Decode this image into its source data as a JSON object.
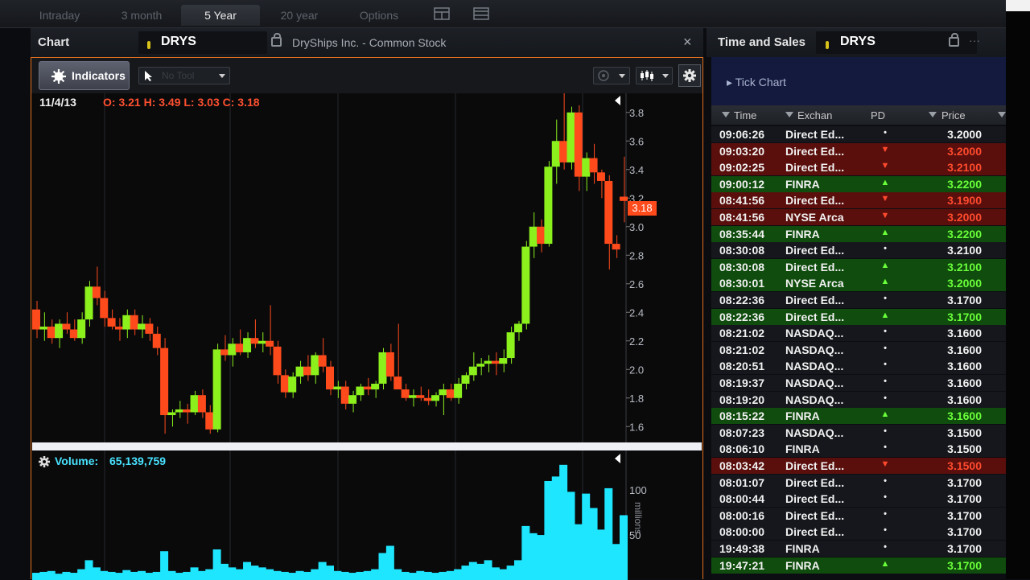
{
  "top_tabs": [
    "Intraday",
    "3 month",
    "5 Year",
    "20 year",
    "Options"
  ],
  "active_tab": "5 Year",
  "chart_header": {
    "title": "Chart",
    "symbol": "DRYS",
    "description": "DryShips Inc. - Common Stock",
    "close": "×"
  },
  "ts_header": {
    "title": "Time and Sales",
    "symbol": "DRYS"
  },
  "toolbar": {
    "indicators": "Indicators",
    "tool_placeholder": "No Tool"
  },
  "ohlc": {
    "date": "11/4/13",
    "text": "O: 3.21 H: 3.49 L: 3.03 C: 3.18"
  },
  "price_badge": "3.18",
  "volume": {
    "label": "Volume:",
    "value": "65,139,759",
    "unit": "millions"
  },
  "tick_chart": "Tick Chart",
  "columns": {
    "time": "Time",
    "exchange": "Exchan",
    "pd": "PD",
    "price": "Price"
  },
  "trades": [
    {
      "time": "09:06:26",
      "exchange": "Direct Ed...",
      "price": "3.2000",
      "dir": "neutral"
    },
    {
      "time": "09:03:20",
      "exchange": "Direct Ed...",
      "price": "3.2000",
      "dir": "red"
    },
    {
      "time": "09:02:25",
      "exchange": "Direct Ed...",
      "price": "3.2100",
      "dir": "red"
    },
    {
      "time": "09:00:12",
      "exchange": "FINRA",
      "price": "3.2200",
      "dir": "green"
    },
    {
      "time": "08:41:56",
      "exchange": "Direct Ed...",
      "price": "3.1900",
      "dir": "red"
    },
    {
      "time": "08:41:56",
      "exchange": "NYSE Arca",
      "price": "3.2000",
      "dir": "red"
    },
    {
      "time": "08:35:44",
      "exchange": "FINRA",
      "price": "3.2200",
      "dir": "green"
    },
    {
      "time": "08:30:08",
      "exchange": "Direct Ed...",
      "price": "3.2100",
      "dir": "neutral"
    },
    {
      "time": "08:30:08",
      "exchange": "Direct Ed...",
      "price": "3.2100",
      "dir": "green"
    },
    {
      "time": "08:30:01",
      "exchange": "NYSE Arca",
      "price": "3.2000",
      "dir": "green"
    },
    {
      "time": "08:22:36",
      "exchange": "Direct Ed...",
      "price": "3.1700",
      "dir": "neutral"
    },
    {
      "time": "08:22:36",
      "exchange": "Direct Ed...",
      "price": "3.1700",
      "dir": "green"
    },
    {
      "time": "08:21:02",
      "exchange": "NASDAQ...",
      "price": "3.1600",
      "dir": "neutral"
    },
    {
      "time": "08:21:02",
      "exchange": "NASDAQ...",
      "price": "3.1600",
      "dir": "neutral"
    },
    {
      "time": "08:20:51",
      "exchange": "NASDAQ...",
      "price": "3.1600",
      "dir": "neutral"
    },
    {
      "time": "08:19:37",
      "exchange": "NASDAQ...",
      "price": "3.1600",
      "dir": "neutral"
    },
    {
      "time": "08:19:20",
      "exchange": "NASDAQ...",
      "price": "3.1600",
      "dir": "neutral"
    },
    {
      "time": "08:15:22",
      "exchange": "FINRA",
      "price": "3.1600",
      "dir": "green"
    },
    {
      "time": "08:07:23",
      "exchange": "NASDAQ...",
      "price": "3.1500",
      "dir": "neutral"
    },
    {
      "time": "08:06:10",
      "exchange": "FINRA",
      "price": "3.1500",
      "dir": "neutral"
    },
    {
      "time": "08:03:42",
      "exchange": "Direct Ed...",
      "price": "3.1500",
      "dir": "red"
    },
    {
      "time": "08:01:07",
      "exchange": "Direct Ed...",
      "price": "3.1700",
      "dir": "neutral"
    },
    {
      "time": "08:00:44",
      "exchange": "Direct Ed...",
      "price": "3.1700",
      "dir": "neutral"
    },
    {
      "time": "08:00:16",
      "exchange": "Direct Ed...",
      "price": "3.1700",
      "dir": "neutral"
    },
    {
      "time": "08:00:00",
      "exchange": "Direct Ed...",
      "price": "3.1700",
      "dir": "neutral"
    },
    {
      "time": "19:49:38",
      "exchange": "FINRA",
      "price": "3.1700",
      "dir": "neutral"
    },
    {
      "time": "19:47:21",
      "exchange": "FINRA",
      "price": "3.1700",
      "dir": "green"
    }
  ],
  "colors": {
    "up": "#8bf01c",
    "down": "#ff4a1c",
    "volume": "#1ee6ff",
    "accent": "#e07020"
  },
  "price_axis": {
    "min": 1.5,
    "max": 3.9,
    "ticks": [
      1.6,
      1.8,
      2.0,
      2.2,
      2.4,
      2.6,
      2.8,
      3.0,
      3.2,
      3.4,
      3.6,
      3.8
    ]
  },
  "volume_axis": {
    "ticks": [
      50,
      100
    ]
  },
  "candles": [
    [
      2.42,
      2.48,
      2.22,
      2.28
    ],
    [
      2.28,
      2.4,
      2.2,
      2.3
    ],
    [
      2.3,
      2.35,
      2.18,
      2.22
    ],
    [
      2.22,
      2.35,
      2.15,
      2.32
    ],
    [
      2.32,
      2.4,
      2.25,
      2.28
    ],
    [
      2.28,
      2.35,
      2.2,
      2.22
    ],
    [
      2.22,
      2.4,
      2.18,
      2.35
    ],
    [
      2.35,
      2.62,
      2.3,
      2.58
    ],
    [
      2.58,
      2.72,
      2.45,
      2.5
    ],
    [
      2.5,
      2.55,
      2.3,
      2.36
    ],
    [
      2.36,
      2.42,
      2.28,
      2.3
    ],
    [
      2.3,
      2.36,
      2.2,
      2.28
    ],
    [
      2.28,
      2.42,
      2.22,
      2.38
    ],
    [
      2.38,
      2.42,
      2.24,
      2.28
    ],
    [
      2.28,
      2.38,
      2.22,
      2.32
    ],
    [
      2.32,
      2.36,
      2.2,
      2.25
    ],
    [
      2.25,
      2.3,
      2.1,
      2.15
    ],
    [
      2.15,
      2.22,
      1.55,
      1.68
    ],
    [
      1.68,
      1.72,
      1.6,
      1.7
    ],
    [
      1.7,
      1.78,
      1.66,
      1.72
    ],
    [
      1.72,
      1.76,
      1.62,
      1.7
    ],
    [
      1.7,
      1.85,
      1.68,
      1.82
    ],
    [
      1.82,
      1.86,
      1.66,
      1.7
    ],
    [
      1.7,
      1.75,
      1.55,
      1.58
    ],
    [
      1.58,
      2.18,
      1.56,
      2.14
    ],
    [
      2.14,
      2.24,
      2.06,
      2.1
    ],
    [
      2.1,
      2.22,
      2.02,
      2.18
    ],
    [
      2.18,
      2.28,
      2.1,
      2.12
    ],
    [
      2.12,
      2.26,
      2.08,
      2.22
    ],
    [
      2.22,
      2.35,
      2.15,
      2.18
    ],
    [
      2.18,
      2.26,
      2.12,
      2.2
    ],
    [
      2.2,
      2.45,
      2.1,
      2.16
    ],
    [
      2.16,
      2.2,
      1.9,
      1.96
    ],
    [
      1.96,
      2.0,
      1.8,
      1.84
    ],
    [
      1.84,
      1.98,
      1.8,
      1.95
    ],
    [
      1.95,
      2.06,
      1.9,
      2.02
    ],
    [
      2.02,
      2.1,
      1.92,
      1.96
    ],
    [
      1.96,
      2.12,
      1.9,
      2.1
    ],
    [
      2.1,
      2.22,
      1.98,
      2.02
    ],
    [
      2.02,
      2.06,
      1.82,
      1.86
    ],
    [
      1.86,
      1.92,
      1.8,
      1.88
    ],
    [
      1.88,
      1.92,
      1.72,
      1.76
    ],
    [
      1.76,
      1.85,
      1.7,
      1.82
    ],
    [
      1.82,
      1.9,
      1.78,
      1.88
    ],
    [
      1.88,
      1.94,
      1.82,
      1.86
    ],
    [
      1.86,
      1.92,
      1.8,
      1.9
    ],
    [
      1.9,
      2.15,
      1.86,
      2.12
    ],
    [
      2.12,
      2.18,
      1.92,
      1.95
    ],
    [
      1.95,
      2.32,
      1.9,
      1.86
    ],
    [
      1.86,
      1.9,
      1.78,
      1.8
    ],
    [
      1.8,
      1.86,
      1.74,
      1.82
    ],
    [
      1.82,
      1.88,
      1.78,
      1.8
    ],
    [
      1.8,
      1.86,
      1.75,
      1.78
    ],
    [
      1.78,
      1.84,
      1.74,
      1.82
    ],
    [
      1.82,
      1.9,
      1.68,
      1.86
    ],
    [
      1.86,
      1.9,
      1.78,
      1.8
    ],
    [
      1.8,
      1.94,
      1.76,
      1.9
    ],
    [
      1.9,
      1.98,
      1.86,
      1.96
    ],
    [
      1.96,
      2.12,
      1.92,
      2.02
    ],
    [
      2.02,
      2.08,
      1.96,
      2.04
    ],
    [
      2.04,
      2.1,
      1.98,
      2.06
    ],
    [
      2.06,
      2.12,
      1.96,
      2.04
    ],
    [
      2.04,
      2.14,
      1.98,
      2.08
    ],
    [
      2.08,
      2.3,
      2.04,
      2.26
    ],
    [
      2.26,
      2.34,
      2.2,
      2.32
    ],
    [
      2.32,
      2.9,
      2.28,
      2.86
    ],
    [
      2.86,
      3.1,
      2.78,
      3.0
    ],
    [
      3.0,
      3.05,
      2.82,
      2.88
    ],
    [
      2.88,
      3.46,
      2.86,
      3.42
    ],
    [
      3.42,
      3.75,
      3.3,
      3.6
    ],
    [
      3.6,
      3.95,
      3.4,
      3.45
    ],
    [
      3.45,
      3.84,
      3.4,
      3.8
    ],
    [
      3.8,
      3.85,
      3.25,
      3.35
    ],
    [
      3.35,
      3.52,
      3.25,
      3.48
    ],
    [
      3.48,
      3.58,
      3.3,
      3.38
    ],
    [
      3.38,
      3.4,
      3.2,
      3.32
    ],
    [
      3.32,
      3.36,
      2.7,
      2.88
    ],
    [
      2.88,
      2.94,
      2.78,
      2.84
    ],
    [
      3.21,
      3.49,
      3.03,
      3.18
    ]
  ],
  "volumes": [
    8,
    9,
    10,
    7,
    9,
    8,
    12,
    22,
    14,
    10,
    9,
    8,
    11,
    9,
    10,
    8,
    9,
    32,
    10,
    8,
    9,
    14,
    10,
    12,
    34,
    18,
    14,
    12,
    20,
    16,
    14,
    12,
    10,
    9,
    8,
    10,
    9,
    12,
    20,
    16,
    10,
    9,
    8,
    9,
    10,
    12,
    30,
    38,
    12,
    9,
    8,
    10,
    9,
    8,
    9,
    10,
    12,
    16,
    20,
    18,
    22,
    14,
    12,
    16,
    22,
    60,
    52,
    50,
    110,
    115,
    128,
    98,
    62,
    96,
    80,
    56,
    102,
    40,
    72
  ]
}
